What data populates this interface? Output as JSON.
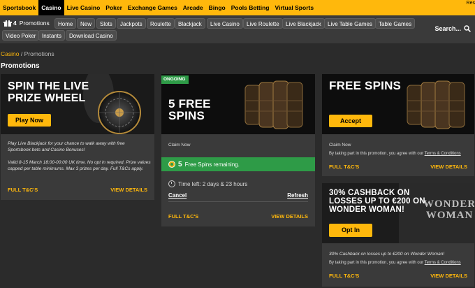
{
  "topnav": {
    "items": [
      "Sportsbook",
      "Casino",
      "Live Casino",
      "Poker",
      "Exchange Games",
      "Arcade",
      "Bingo",
      "Pools Betting",
      "Virtual Sports"
    ],
    "active_index": 1,
    "right_text": "Res"
  },
  "subnav": {
    "promotions_count": "4",
    "promotions_label": "Promotions",
    "pills": [
      "Home",
      "New",
      "Slots",
      "Jackpots",
      "Roulette",
      "Blackjack",
      "Live Casino",
      "Live Roulette",
      "Live Blackjack",
      "Live Table Games",
      "Table Games",
      "Video Poker",
      "Instants",
      "Download Casino"
    ],
    "search_label": "Search..."
  },
  "breadcrumb": {
    "root": "Casino",
    "separator": "/",
    "current": "Promotions"
  },
  "page_title": "Promotions",
  "cards": {
    "wheel": {
      "headline_line1": "SPIN THE LIVE",
      "headline_line2": "PRIZE WHEEL",
      "button": "Play Now",
      "description": "Play Live Blackjack for your chance to walk away with free Sportsbook bets and Casino Bonuses!",
      "terms": "Valid 8-15 March 18:00-00:00 UK time. No opt in required. Prize values capped per table minimums. Max 3 prizes per day. Full T&Cs apply.",
      "full_tcs": "FULL T&C'S",
      "view_details": "VIEW DETAILS"
    },
    "five_spins": {
      "badge": "ONGOING",
      "headline_line1": "5 FREE",
      "headline_line2": "SPINS",
      "claim_now": "Claim Now",
      "spins_count": "5",
      "spins_label": "Free Spins remaining.",
      "time_left": "Time left: 2 days & 23 hours",
      "cancel": "Cancel",
      "refresh": "Refresh",
      "full_tcs": "FULL T&C'S",
      "view_details": "VIEW DETAILS"
    },
    "free_spins": {
      "headline": "FREE SPINS",
      "button": "Accept",
      "claim_now": "Claim Now",
      "agree_prefix": "By taking part in this promotion, you agree with our",
      "terms_link": "Terms & Conditions",
      "full_tcs": "FULL T&C'S",
      "view_details": "VIEW DETAILS"
    },
    "cashback": {
      "headline_line1": "30% CASHBACK ON",
      "headline_line2": "LOSSES UP TO €200 ON",
      "headline_line3": "WONDER WOMAN!",
      "logo_text_1": "WONDER",
      "logo_text_2": "WOMAN",
      "button": "Opt In",
      "description": "30% Cashback on losses up to €200 on Wonder Woman!",
      "agree_prefix": "By taking part in this promotion, you agree with our",
      "terms_link": "Terms & Conditions",
      "full_tcs": "FULL T&C'S",
      "view_details": "VIEW DETAILS"
    }
  },
  "colors": {
    "accent": "#ffb80c",
    "green": "#2e9b47",
    "background": "#2b2b2b",
    "card": "#3a3a3a"
  }
}
